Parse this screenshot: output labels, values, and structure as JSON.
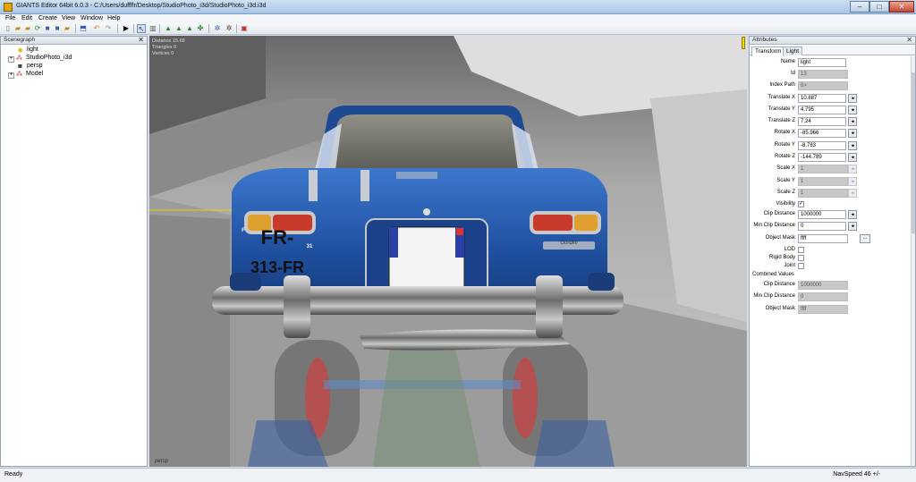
{
  "window": {
    "title": "GIANTS Editor 64bit 6.0.3 - C:/Users/duffffr/Desktop/StudioPhoto_i3d/StudioPhoto_i3d.i3d",
    "minimize": "–",
    "maximize": "□",
    "close": "✕"
  },
  "menu": [
    "File",
    "Edit",
    "Create",
    "View",
    "Window",
    "Help"
  ],
  "scenegraph": {
    "title": "Scenegraph",
    "close": "✕",
    "items": [
      {
        "label": "light",
        "icon": "lightbulb-icon",
        "expand": ""
      },
      {
        "label": "StudioPhoto_i3d",
        "icon": "transform-group-icon",
        "expand": "+"
      },
      {
        "label": "persp",
        "icon": "camera-icon",
        "expand": ""
      },
      {
        "label": "Model",
        "icon": "transform-group-icon",
        "expand": "+"
      }
    ]
  },
  "viewport": {
    "stats": [
      "Distance 15.68",
      "Triangles 0",
      "Vertices 0"
    ],
    "camera": "persp",
    "plate_line1": "FR-",
    "plate_line2": "313-FR",
    "plate_country": "F",
    "plate_region": "31",
    "badge": "Gordini"
  },
  "attributes": {
    "title": "Attributes",
    "close": "✕",
    "tabs": [
      "Transform",
      "Light"
    ],
    "name_label": "Name",
    "name_value": "light",
    "id_label": "Id",
    "id_value": "13",
    "index_label": "Index Path",
    "index_value": "0>",
    "tx_label": "Translate X",
    "tx_value": "10.887",
    "ty_label": "Translate Y",
    "ty_value": "4.795",
    "tz_label": "Translate Z",
    "tz_value": "7.24",
    "rx_label": "Rotate X",
    "rx_value": "-85.966",
    "ry_label": "Rotate Y",
    "ry_value": "-8.783",
    "rz_label": "Rotate Z",
    "rz_value": "-144.789",
    "sx_label": "Scale X",
    "sx_value": "1",
    "sy_label": "Scale Y",
    "sy_value": "1",
    "sz_label": "Scale Z",
    "sz_value": "1",
    "visibility_label": "Visibility",
    "clip_label": "Clip Distance",
    "clip_value": "1000000",
    "minclip_label": "Min Clip Distance",
    "minclip_value": "0",
    "mask_label": "Object Mask",
    "mask_value": "ffff",
    "mask_button": "...",
    "lod_label": "LOD",
    "rigid_label": "Rigid Body",
    "joint_label": "Joint",
    "combined_label": "Combined Values",
    "c_clip_label": "Clip Distance",
    "c_clip_value": "1000000",
    "c_minclip_label": "Min Clip Distance",
    "c_minclip_value": "0",
    "c_mask_label": "Object Mask",
    "c_mask_value": "ffff",
    "spin": "◂▸",
    "check": "✓"
  },
  "status": {
    "left": "Ready",
    "right": "NavSpeed 46 +/-"
  },
  "colors": {
    "car_body": "#2a5fb0",
    "selection_handle": "#f3d400",
    "readonly_field": "#c8c8c8"
  }
}
